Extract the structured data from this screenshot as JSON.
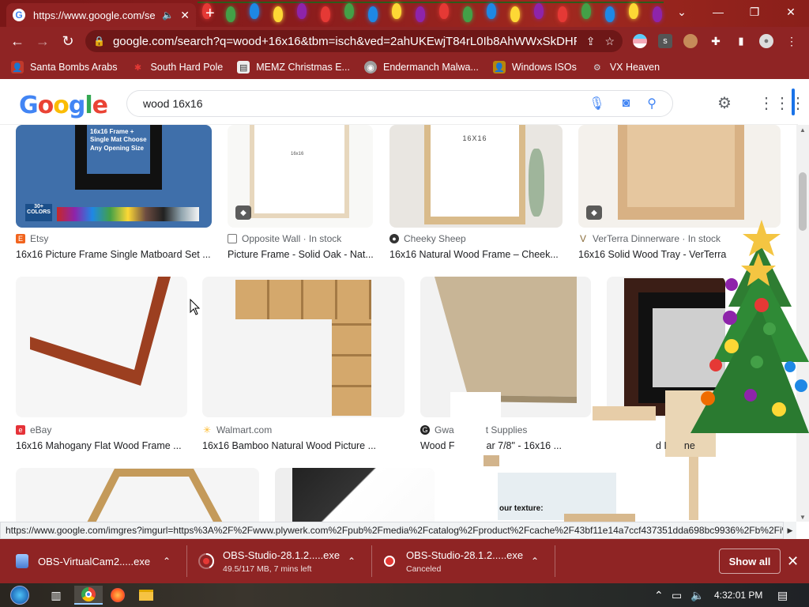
{
  "browser": {
    "tab_title": "https://www.google.com/sea",
    "url": "google.com/search?q=wood+16x16&tbm=isch&ved=2ahUKEwjT84rL0Ib8AhWWxSkDHRijC...",
    "bookmarks": [
      {
        "label": "Santa Bombs Arabs",
        "icon": "person-icon",
        "color": "#c0392b"
      },
      {
        "label": "South Hard Pole",
        "icon": "snowflake-icon",
        "color": "#e53935"
      },
      {
        "label": "MEMZ Christmas E...",
        "icon": "file-icon",
        "color": "#eeeeee"
      },
      {
        "label": "Endermanch Malwa...",
        "icon": "raccoon-icon",
        "color": "#9e9e9e"
      },
      {
        "label": "Windows ISOs",
        "icon": "person-icon",
        "color": "#b8860b"
      },
      {
        "label": "VX Heaven",
        "icon": "gear-icon",
        "color": "#cfd8dc"
      }
    ]
  },
  "google": {
    "logo": "Google",
    "query": "wood 16x16"
  },
  "results": [
    {
      "source": "Etsy",
      "title": "16x16 Picture Frame Single Matboard Set ...",
      "thumb_text": "16x16 Frame + Single Mat Choose Any Opening Size",
      "badge": "30+ COLORS"
    },
    {
      "source": "Opposite Wall · In stock",
      "title": "Picture Frame - Solid Oak - Nat...",
      "thumb_text": "16x16"
    },
    {
      "source": "Cheeky Sheep",
      "title": "16x16 Natural Wood Frame – Cheek...",
      "thumb_text": "16X16"
    },
    {
      "source": "VerTerra Dinnerware · In stock",
      "title": "16x16 Solid Wood Tray - VerTerra Din"
    },
    {
      "source": "eBay",
      "title": "16x16 Mahogany Flat Wood Frame ..."
    },
    {
      "source": "Walmart.com",
      "title": "16x16 Bamboo Natural Wood Picture ..."
    },
    {
      "source": "Gwa",
      "source_tail": "t Supplies",
      "title": "Wood F",
      "title_tail": "ar 7/8\" - 16x16 ..."
    },
    {
      "source": "",
      "title": "d I",
      "title_tail": "ne"
    }
  ],
  "row3_text": "our texture:",
  "status_url": "https://www.google.com/imgres?imgurl=https%3A%2F%2Fwww.plywerk.com%2Fpub%2Fmedia%2Fcatalog%2Fproduct%2Fcache%2F43bf11e14a7ccf437351dda698bc9936%2Fb%2Fi%...",
  "downloads": [
    {
      "name": "OBS-VirtualCam2.....exe",
      "sub": ""
    },
    {
      "name": "OBS-Studio-28.1.2.....exe",
      "sub": "49.5/117 MB, 7 mins left",
      "progress": 0.42
    },
    {
      "name": "OBS-Studio-28.1.2.....exe",
      "sub": "Canceled"
    }
  ],
  "show_all": "Show all",
  "clock": "4:32:01 PM",
  "colors": {
    "chrome_red": "#8f2424",
    "google_blue": "#4285f4",
    "link_blue": "#1a73e8"
  }
}
